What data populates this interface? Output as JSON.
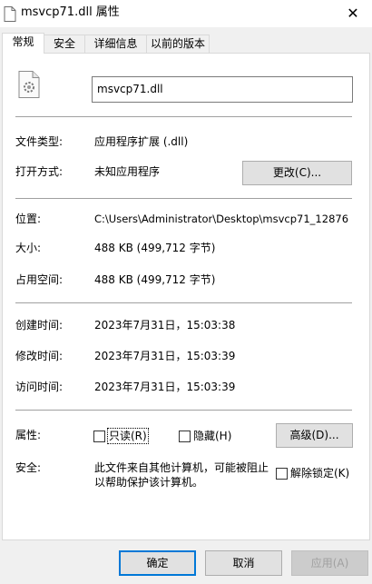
{
  "window": {
    "title": "msvcp71.dll 属性",
    "close_glyph": "✕",
    "file_icon": "gear-document-icon",
    "title_icon": "document-icon"
  },
  "tabs": [
    {
      "label": "常规",
      "active": true
    },
    {
      "label": "安全",
      "active": false
    },
    {
      "label": "详细信息",
      "active": false
    },
    {
      "label": "以前的版本",
      "active": false
    }
  ],
  "general": {
    "filename": "msvcp71.dll",
    "file_type_label": "文件类型:",
    "file_type_value": "应用程序扩展 (.dll)",
    "open_with_label": "打开方式:",
    "open_with_value": "未知应用程序",
    "change_button": "更改(C)...",
    "location_label": "位置:",
    "location_value": "C:\\Users\\Administrator\\Desktop\\msvcp71_12876",
    "size_label": "大小:",
    "size_value": "488 KB (499,712 字节)",
    "size_on_disk_label": "占用空间:",
    "size_on_disk_value": "488 KB (499,712 字节)",
    "created_label": "创建时间:",
    "created_value": "2023年7月31日，15:03:38",
    "modified_label": "修改时间:",
    "modified_value": "2023年7月31日，15:03:39",
    "accessed_label": "访问时间:",
    "accessed_value": "2023年7月31日，15:03:39",
    "attributes_label": "属性:",
    "readonly_label": "只读(R)",
    "readonly_checked": false,
    "hidden_label": "隐藏(H)",
    "hidden_checked": false,
    "advanced_button": "高级(D)...",
    "security_label": "安全:",
    "security_text_line1": "此文件来自其他计算机，可能被阻止",
    "security_text_line2": "以帮助保护该计算机。",
    "unblock_label": "解除锁定(K)",
    "unblock_checked": false
  },
  "footer": {
    "ok": "确定",
    "cancel": "取消",
    "apply": "应用(A)"
  },
  "colors": {
    "focus_border": "#0078d7",
    "separator": "#a0a0a0",
    "disabled_text": "#a0a0a0"
  }
}
